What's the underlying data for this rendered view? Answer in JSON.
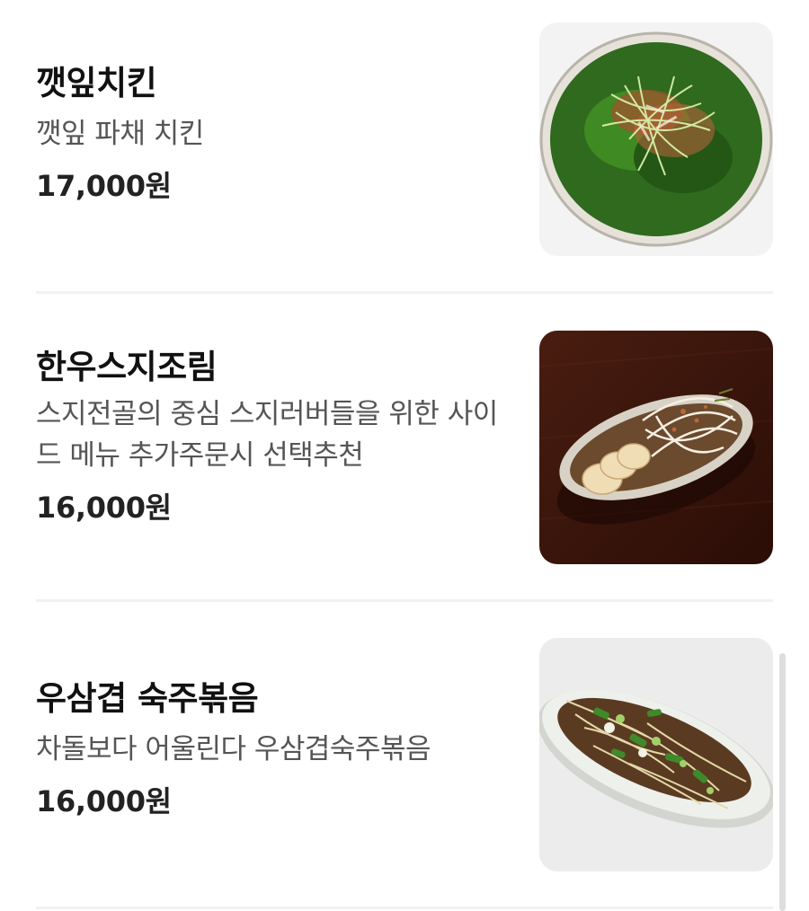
{
  "menu": {
    "items": [
      {
        "name": "깻잎치킨",
        "description": "깻잎 파채 치킨",
        "price": "17,000원",
        "image_icon": "perilla-chicken-photo"
      },
      {
        "name": "한우스지조림",
        "description": "스지전골의 중심 스지러버들을 위한 사이드 메뉴 추가주문시 선택추천",
        "price": "16,000원",
        "image_icon": "braised-beef-tendon-photo"
      },
      {
        "name": "우삼겹 숙주볶음",
        "description": "차돌보다 어울린다 우삼겹숙주볶음",
        "price": "16,000원",
        "image_icon": "beef-brisket-bean-sprout-photo"
      }
    ]
  }
}
